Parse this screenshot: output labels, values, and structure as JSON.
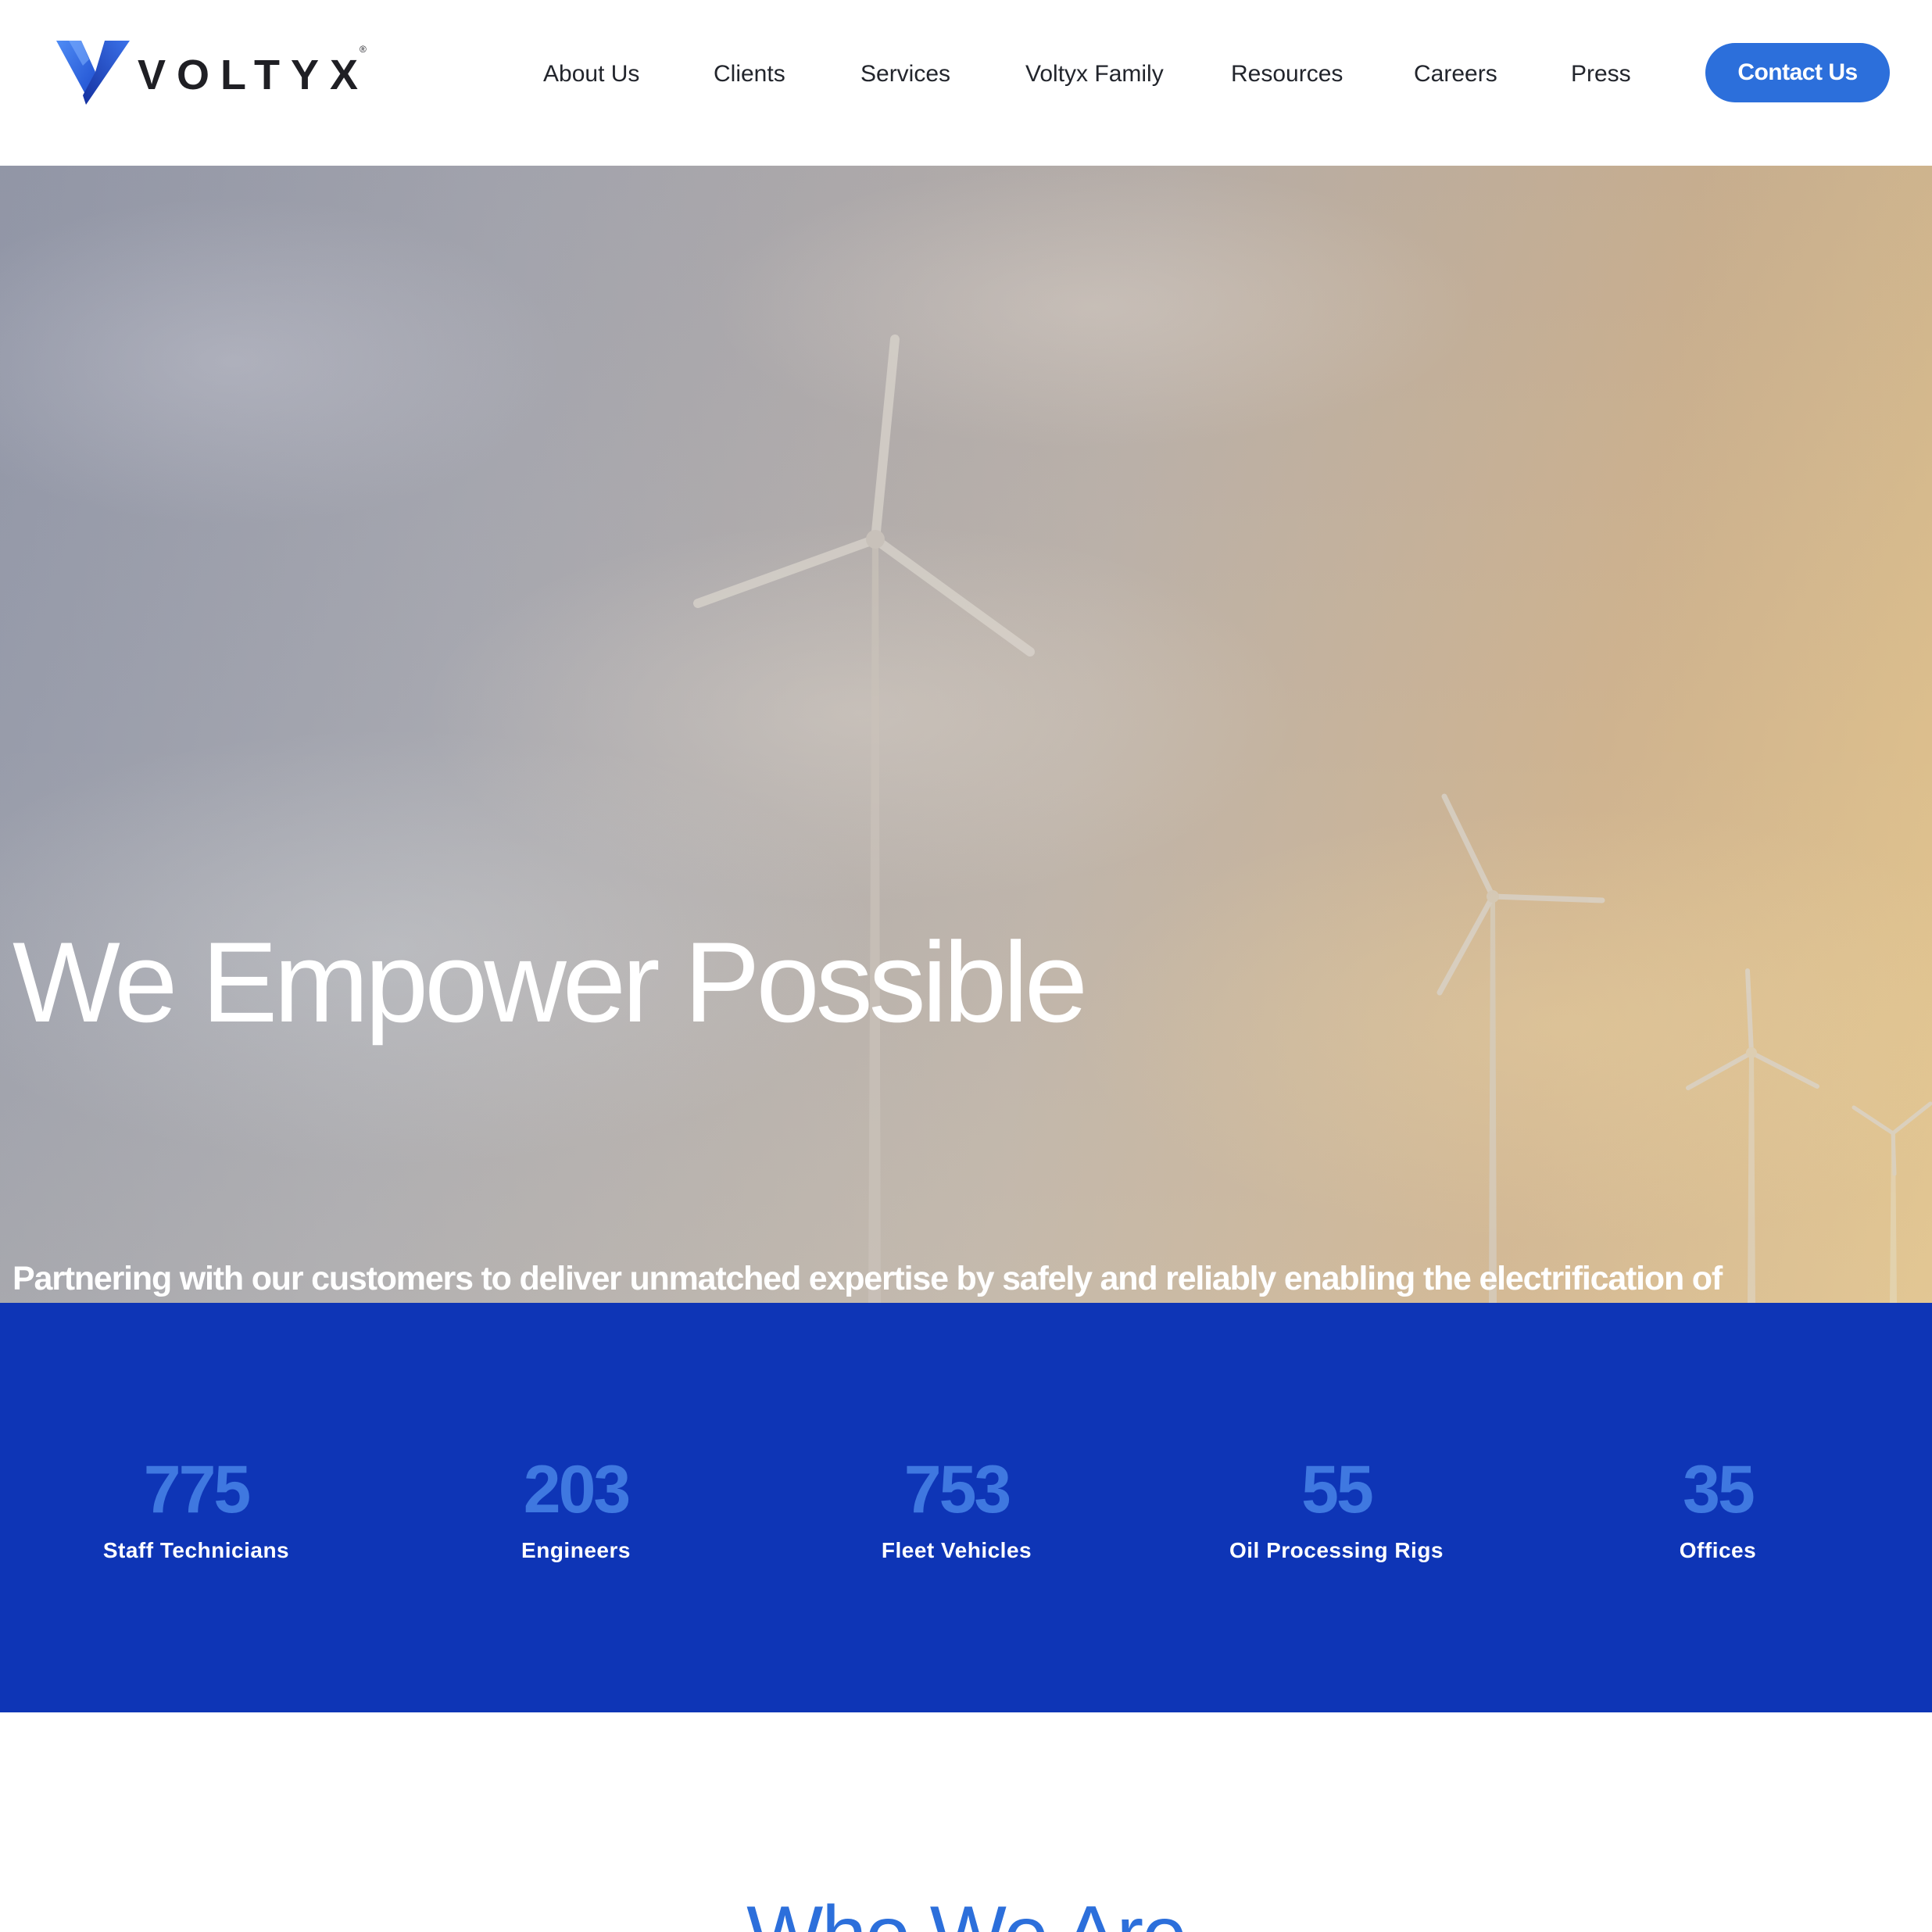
{
  "brand": {
    "name": "VOLTYX",
    "registered_mark": "®"
  },
  "nav": {
    "items": [
      {
        "label": "About Us"
      },
      {
        "label": "Clients"
      },
      {
        "label": "Services"
      },
      {
        "label": "Voltyx Family"
      },
      {
        "label": "Resources"
      },
      {
        "label": "Careers"
      },
      {
        "label": "Press"
      }
    ],
    "cta_label": "Contact Us"
  },
  "hero": {
    "title": "We Empower Possible",
    "subtitle": "Partnering with our customers to deliver unmatched expertise by safely and reliably enabling the electrification of everything.",
    "background_image": "wind-turbines-sky"
  },
  "stats": [
    {
      "value": "775",
      "label": "Staff Technicians"
    },
    {
      "value": "203",
      "label": "Engineers"
    },
    {
      "value": "753",
      "label": "Fleet Vehicles"
    },
    {
      "value": "55",
      "label": "Oil Processing Rigs"
    },
    {
      "value": "35",
      "label": "Offices"
    }
  ],
  "who_we_are": {
    "title": "Who We Are"
  },
  "colors": {
    "accent": "#2c6fdb",
    "stats_background": "#0e35b6",
    "stat_number": "#3f78e0",
    "text_dark": "#22252c",
    "logo_blue_light": "#3a7cf0",
    "logo_blue_dark": "#1838b8"
  }
}
